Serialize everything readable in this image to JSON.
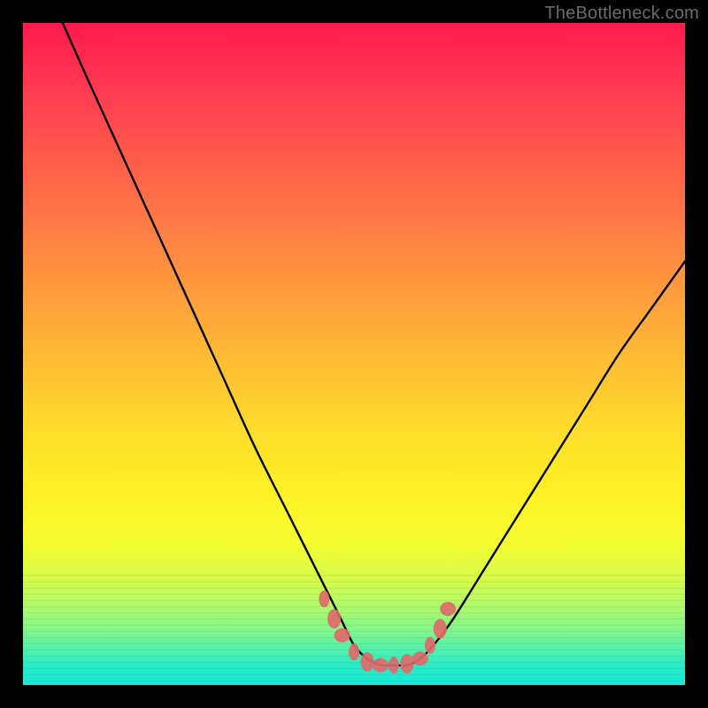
{
  "watermark": "TheBottleneck.com",
  "chart_data": {
    "type": "line",
    "title": "",
    "xlabel": "",
    "ylabel": "",
    "xlim": [
      0,
      100
    ],
    "ylim": [
      0,
      100
    ],
    "grid": false,
    "legend": false,
    "series": [
      {
        "name": "bottleneck-curve",
        "x": [
          6,
          10,
          15,
          20,
          25,
          30,
          35,
          40,
          45,
          48,
          50,
          52,
          54,
          56,
          58,
          60,
          62,
          65,
          70,
          75,
          80,
          85,
          90,
          95,
          100
        ],
        "y": [
          100,
          91,
          80,
          69,
          58,
          47,
          36,
          26,
          16,
          10,
          6,
          4,
          3,
          3,
          3,
          4,
          6,
          10,
          18,
          26,
          34,
          42,
          50,
          57,
          64
        ]
      }
    ],
    "markers": {
      "name": "highlight-dots",
      "color": "#e06a6a",
      "x": [
        45.5,
        47.0,
        48.2,
        50.0,
        52.0,
        54.0,
        56.0,
        58.0,
        60.0,
        61.5,
        63.0,
        64.2
      ],
      "y": [
        13.0,
        10.0,
        7.5,
        5.0,
        3.5,
        3.0,
        3.0,
        3.2,
        4.0,
        6.0,
        8.5,
        11.5
      ]
    },
    "gradient_stops": [
      {
        "pos": 0.0,
        "color": "#ff1a4d"
      },
      {
        "pos": 0.5,
        "color": "#ffba36"
      },
      {
        "pos": 0.78,
        "color": "#f6fc2e"
      },
      {
        "pos": 0.92,
        "color": "#7ef58d"
      },
      {
        "pos": 1.0,
        "color": "#18e9d5"
      }
    ]
  }
}
